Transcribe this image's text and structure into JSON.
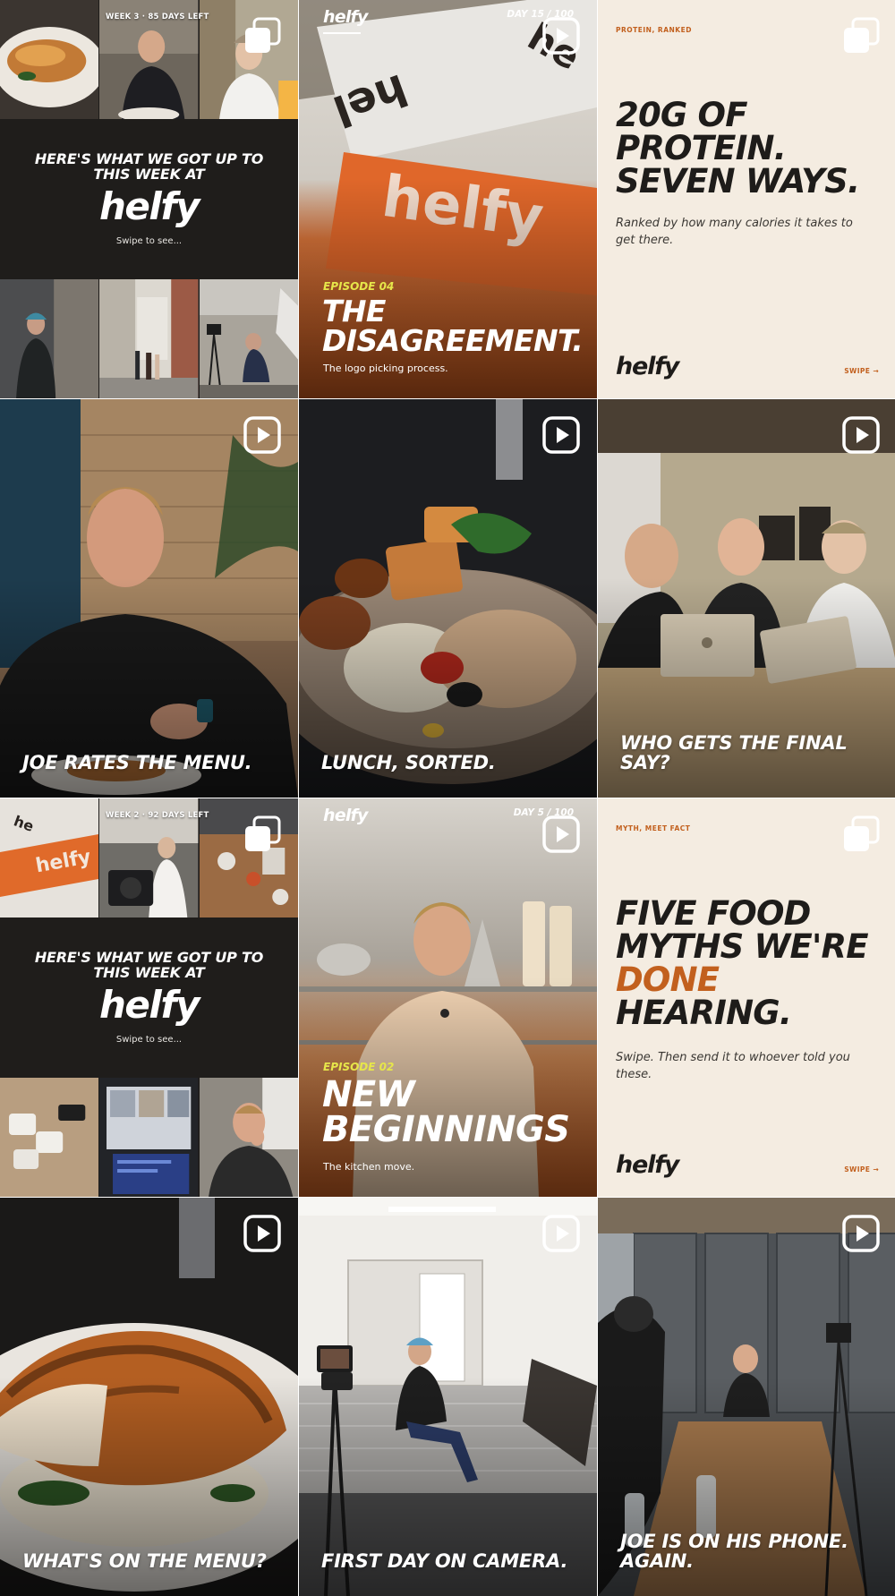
{
  "brand": "helfy",
  "colors": {
    "accent": "#c2601e",
    "cream": "#f4ece1",
    "dark": "#1f1d1b",
    "episode_yellow": "#e6e64a"
  },
  "icons": {
    "carousel": "carousel-icon",
    "reel": "play-icon"
  },
  "posts": [
    {
      "id": 1,
      "kind": "carousel",
      "week_label": "WEEK 3 · 85 DAYS LEFT",
      "headline": "HERE'S WHAT WE GOT UP TO THIS WEEK AT",
      "logo": "helfy",
      "swipe": "Swipe to see..."
    },
    {
      "id": 2,
      "kind": "reel",
      "logo": "helfy",
      "day": "DAY 15 / 100",
      "episode": "EPISODE 04",
      "title": "THE DISAGREEMENT.",
      "subtitle": "The logo picking process."
    },
    {
      "id": 3,
      "kind": "carousel",
      "kicker": "PROTEIN, RANKED",
      "title": "20G OF PROTEIN. SEVEN WAYS.",
      "body": "Ranked by how many calories it takes to get there.",
      "logo": "helfy",
      "swipe": "SWIPE →"
    },
    {
      "id": 4,
      "kind": "reel",
      "caption": "JOE RATES THE MENU."
    },
    {
      "id": 5,
      "kind": "reel",
      "caption": "LUNCH, SORTED."
    },
    {
      "id": 6,
      "kind": "reel",
      "caption": "WHO GETS THE FINAL SAY?"
    },
    {
      "id": 7,
      "kind": "carousel",
      "week_label": "WEEK 2 · 92 DAYS LEFT",
      "headline": "HERE'S WHAT WE GOT UP TO THIS WEEK AT",
      "logo": "helfy",
      "swipe": "Swipe to see..."
    },
    {
      "id": 8,
      "kind": "reel",
      "logo": "helfy",
      "day": "DAY 5 / 100",
      "episode": "EPISODE 02",
      "title": "NEW BEGINNINGS",
      "subtitle": "The kitchen move."
    },
    {
      "id": 9,
      "kind": "carousel",
      "kicker": "MYTH, MEET FACT",
      "title_lines": [
        "FIVE FOOD",
        "MYTHS WE'RE",
        "DONE",
        "HEARING."
      ],
      "body": "Swipe. Then send it to whoever told you these.",
      "logo": "helfy",
      "swipe": "SWIPE →"
    },
    {
      "id": 10,
      "kind": "reel",
      "caption": "WHAT'S ON THE MENU?"
    },
    {
      "id": 11,
      "kind": "reel",
      "caption": "FIRST DAY ON CAMERA."
    },
    {
      "id": 12,
      "kind": "reel",
      "caption": "JOE IS ON HIS PHONE. AGAIN."
    }
  ]
}
